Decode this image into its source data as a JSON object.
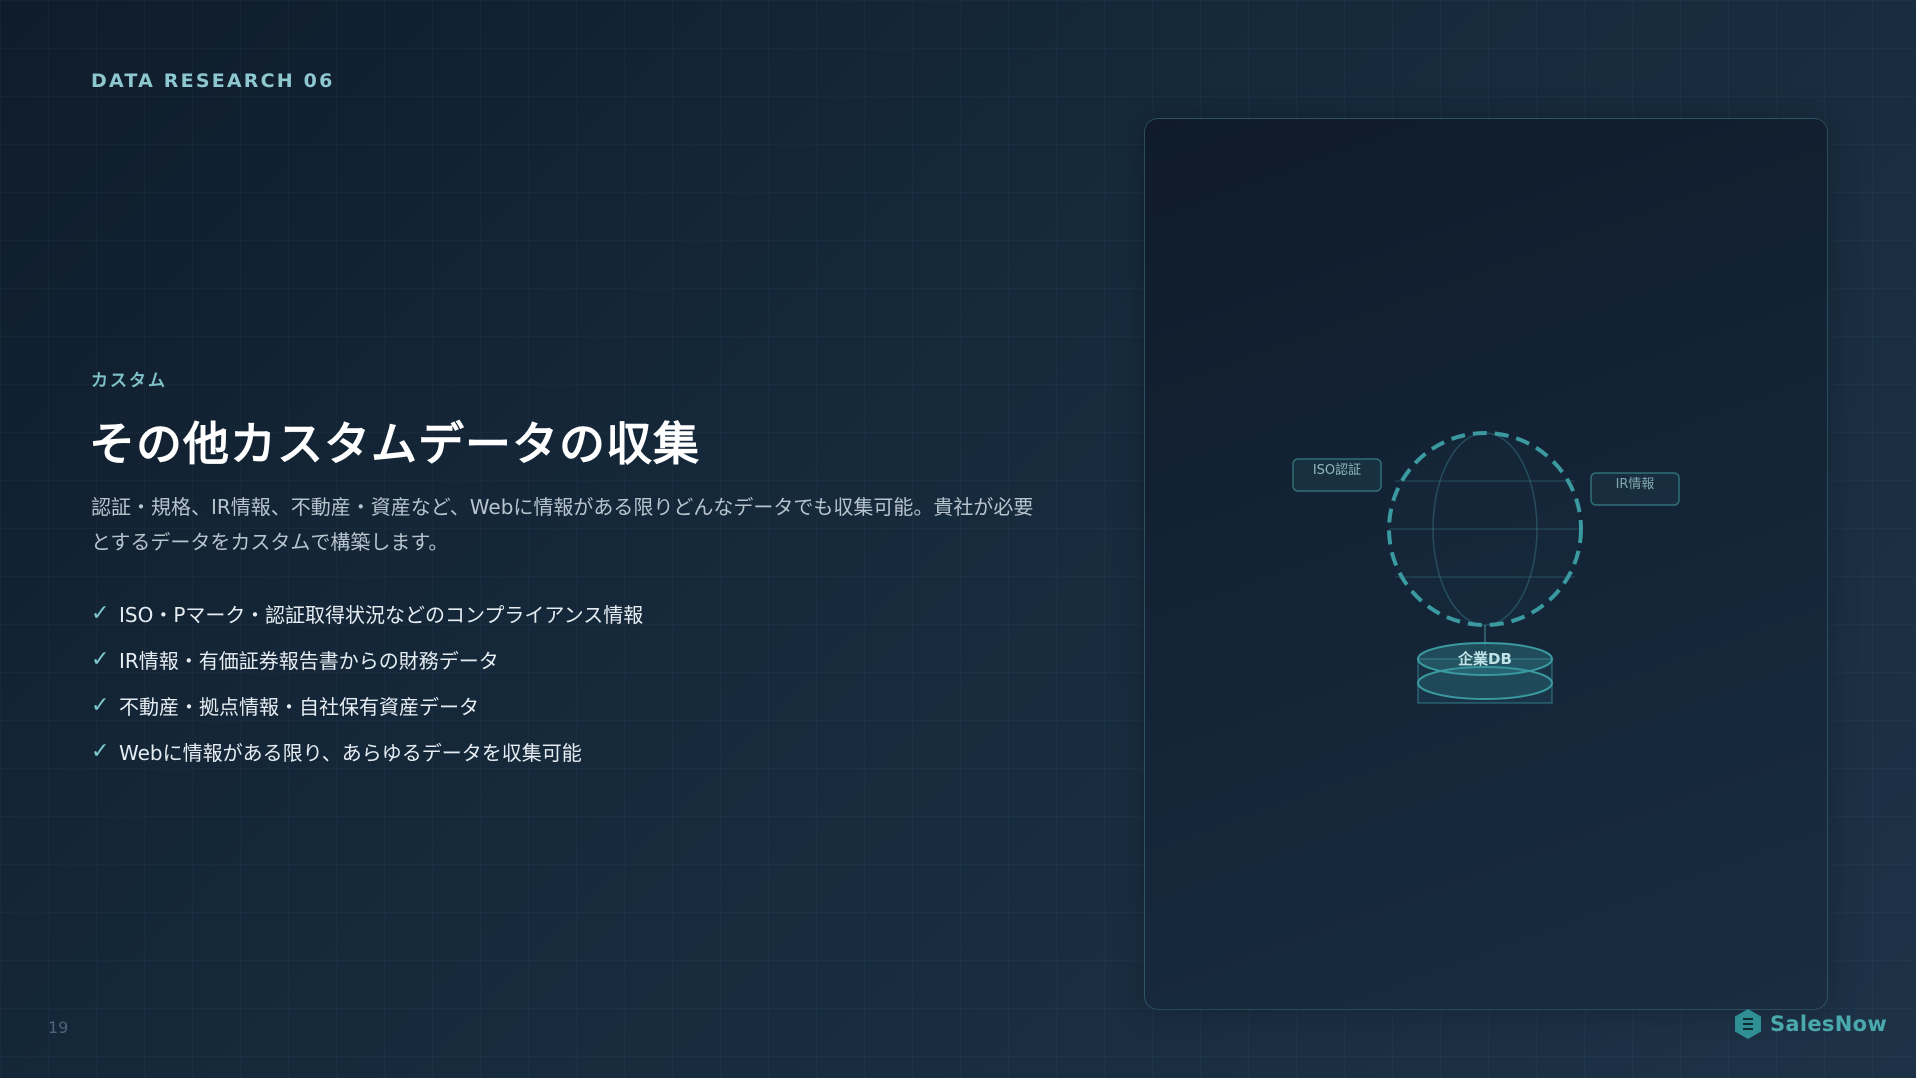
{
  "header": {
    "eyebrow": "DATA RESEARCH 06"
  },
  "content": {
    "section_label": "カスタム",
    "title": "その他カスタムデータの収集",
    "description": "認証・規格、IR情報、不動産・資産など、Webに情報がある限りどんなデータでも収集可能。貴社が必要とするデータをカスタムで構築します。",
    "features": [
      {
        "check": "✓",
        "text": "ISO・Pマーク・認証取得状況などのコンプライアンス情報"
      },
      {
        "check": "✓",
        "text": "IR情報・有価証券報告書からの財務データ"
      },
      {
        "check": "✓",
        "text": "不動産・拠点情報・自社保有資産データ"
      },
      {
        "check": "✓",
        "text": "Webに情報がある限り、あらゆるデータを収集可能"
      }
    ]
  },
  "diagram": {
    "left_tag": "ISO認証",
    "right_tag": "IR情報",
    "db_label": "企業DB",
    "colors": {
      "accent": "#3fa3a8",
      "tag_border": "#2f6f78",
      "tag_text": "#8fb8c2"
    }
  },
  "footer": {
    "page_number": "19",
    "brand": "SalesNow",
    "brand_icon": "hexagon-logo-icon"
  }
}
